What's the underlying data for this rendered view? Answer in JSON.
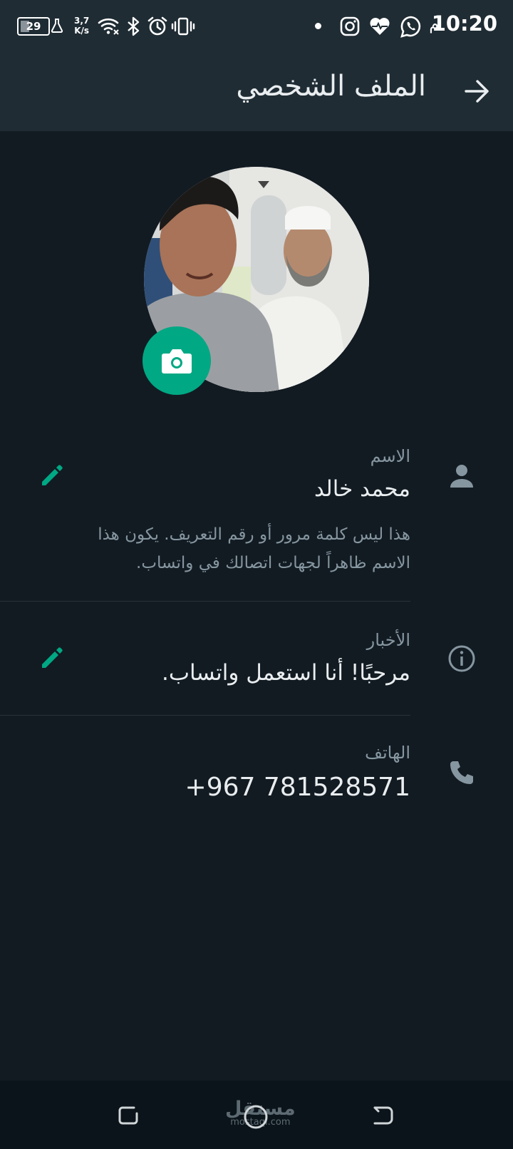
{
  "status_bar": {
    "time": "10:20",
    "ampm": "م",
    "battery": "29",
    "net_speed_value": "3,7",
    "net_speed_unit": "K/s",
    "left_icons": [
      "battery-icon",
      "flask-icon",
      "network-speed",
      "wifi-icon",
      "bluetooth-icon",
      "alarm-icon",
      "vibrate-icon"
    ],
    "right_icons": [
      "notification-dot",
      "instagram-icon",
      "health-heart-icon",
      "whatsapp-icon"
    ]
  },
  "app_bar": {
    "title": "الملف الشخصي",
    "back_icon": "arrow-back-icon"
  },
  "profile": {
    "camera_icon": "camera-icon"
  },
  "fields": {
    "name": {
      "icon": "person-icon",
      "label": "الاسم",
      "value": "محمد خالد",
      "hint": "هذا ليس كلمة مرور أو رقم التعريف. يكون هذا الاسم ظاهراً لجهات اتصالك في واتساب.",
      "edit_icon": "pencil-icon"
    },
    "about": {
      "icon": "info-icon",
      "label": "الأخبار",
      "value": "مرحبًا! أنا استعمل واتساب.",
      "edit_icon": "pencil-icon"
    },
    "phone": {
      "icon": "phone-icon",
      "label": "الهاتف",
      "value": "+967 781528571"
    }
  },
  "nav_bar": {
    "buttons": [
      "recents-button",
      "home-button",
      "back-button"
    ],
    "watermark": "مستقل",
    "watermark_sub": "mostaql.com"
  },
  "colors": {
    "background": "#121b22",
    "app_bar": "#1f2c34",
    "accent": "#00a884",
    "primary_text": "#e9edef",
    "secondary_text": "#8696a0"
  }
}
